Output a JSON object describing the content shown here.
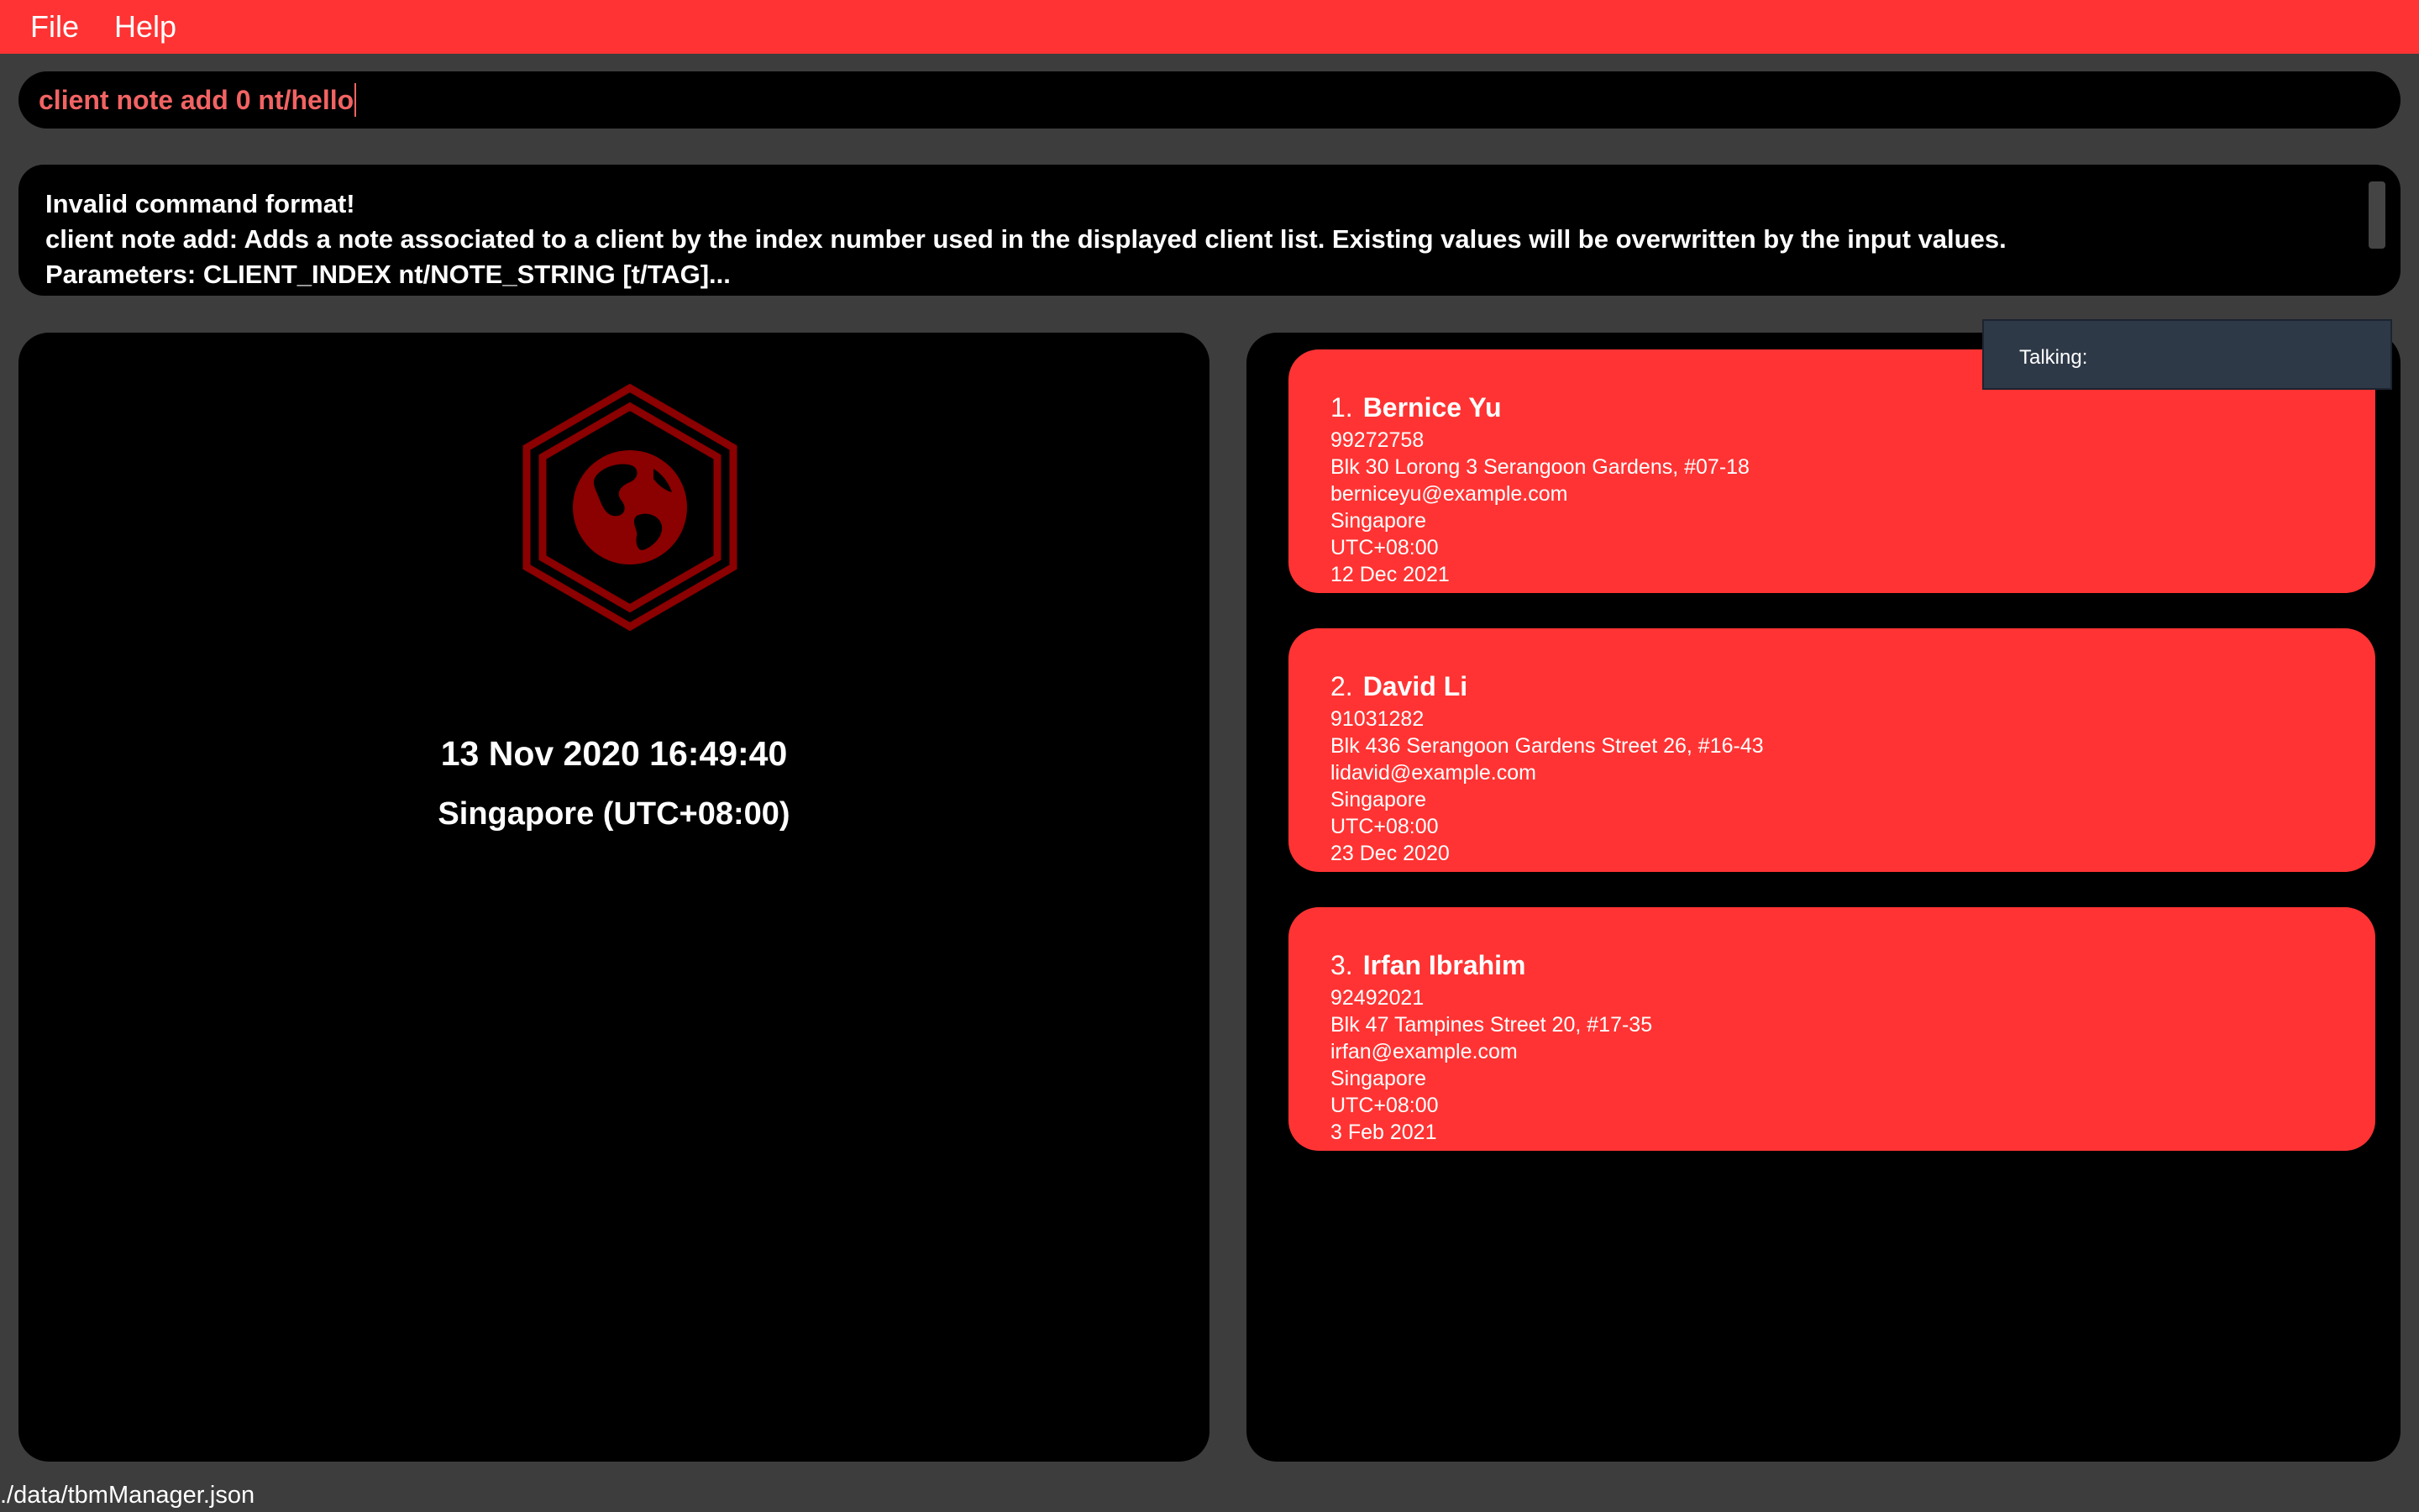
{
  "menu": {
    "file": "File",
    "help": "Help"
  },
  "command": {
    "value": "client note add 0 nt/hello"
  },
  "result": {
    "lines": [
      "Invalid command format!",
      "client note add: Adds a note associated to a client by the index number used in the displayed client list. Existing values will be overwritten by the input values.",
      "Parameters: CLIENT_INDEX nt/NOTE_STRING [t/TAG]..."
    ]
  },
  "clock": {
    "datetime": "13 Nov 2020 16:49:40",
    "timezone": "Singapore (UTC+08:00)",
    "logo_icon": "globe-hexagon-icon",
    "logo_color": "#8b0000"
  },
  "tooltip": {
    "label": "Talking:"
  },
  "clients": [
    {
      "index": "1.",
      "name": "Bernice Yu",
      "phone": "99272758",
      "address": "Blk 30 Lorong 3 Serangoon Gardens, #07-18",
      "email": "berniceyu@example.com",
      "country": "Singapore",
      "timezone": "UTC+08:00",
      "date": "12 Dec 2021"
    },
    {
      "index": "2.",
      "name": "David Li",
      "phone": "91031282",
      "address": "Blk 436 Serangoon Gardens Street 26, #16-43",
      "email": "lidavid@example.com",
      "country": "Singapore",
      "timezone": "UTC+08:00",
      "date": "23 Dec 2020"
    },
    {
      "index": "3.",
      "name": "Irfan Ibrahim",
      "phone": "92492021",
      "address": "Blk 47 Tampines Street 20, #17-35",
      "email": "irfan@example.com",
      "country": "Singapore",
      "timezone": "UTC+08:00",
      "date": "3 Feb 2021"
    }
  ],
  "status": {
    "path": "./data/tbmManager.json"
  },
  "colors": {
    "accent": "#ff3333",
    "background": "#3d3d3d",
    "panel": "#000000",
    "command_text": "#f26363"
  }
}
